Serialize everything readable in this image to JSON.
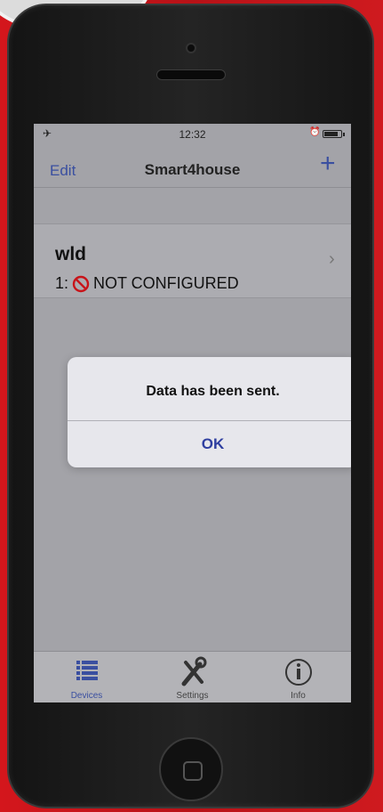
{
  "status_bar": {
    "time": "12:32"
  },
  "nav": {
    "edit_label": "Edit",
    "title": "Smart4house",
    "add_label": "+"
  },
  "device": {
    "name": "wld",
    "index": "1:",
    "status": "NOT CONFIGURED"
  },
  "alert": {
    "message": "Data has been sent.",
    "ok_label": "OK"
  },
  "tabs": [
    {
      "label": "Devices",
      "icon": "list-icon",
      "active": true
    },
    {
      "label": "Settings",
      "icon": "tools-icon",
      "active": false
    },
    {
      "label": "Info",
      "icon": "info-icon",
      "active": false
    }
  ],
  "colors": {
    "accent": "#3a4fa0",
    "no_sign": "#c8141a"
  }
}
